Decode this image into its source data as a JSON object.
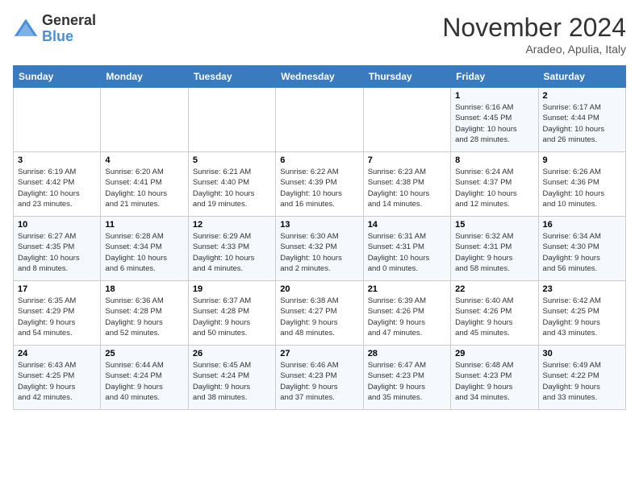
{
  "header": {
    "logo_line1": "General",
    "logo_line2": "Blue",
    "month": "November 2024",
    "location": "Aradeo, Apulia, Italy"
  },
  "weekdays": [
    "Sunday",
    "Monday",
    "Tuesday",
    "Wednesday",
    "Thursday",
    "Friday",
    "Saturday"
  ],
  "weeks": [
    [
      {
        "day": "",
        "info": ""
      },
      {
        "day": "",
        "info": ""
      },
      {
        "day": "",
        "info": ""
      },
      {
        "day": "",
        "info": ""
      },
      {
        "day": "",
        "info": ""
      },
      {
        "day": "1",
        "info": "Sunrise: 6:16 AM\nSunset: 4:45 PM\nDaylight: 10 hours\nand 28 minutes."
      },
      {
        "day": "2",
        "info": "Sunrise: 6:17 AM\nSunset: 4:44 PM\nDaylight: 10 hours\nand 26 minutes."
      }
    ],
    [
      {
        "day": "3",
        "info": "Sunrise: 6:19 AM\nSunset: 4:42 PM\nDaylight: 10 hours\nand 23 minutes."
      },
      {
        "day": "4",
        "info": "Sunrise: 6:20 AM\nSunset: 4:41 PM\nDaylight: 10 hours\nand 21 minutes."
      },
      {
        "day": "5",
        "info": "Sunrise: 6:21 AM\nSunset: 4:40 PM\nDaylight: 10 hours\nand 19 minutes."
      },
      {
        "day": "6",
        "info": "Sunrise: 6:22 AM\nSunset: 4:39 PM\nDaylight: 10 hours\nand 16 minutes."
      },
      {
        "day": "7",
        "info": "Sunrise: 6:23 AM\nSunset: 4:38 PM\nDaylight: 10 hours\nand 14 minutes."
      },
      {
        "day": "8",
        "info": "Sunrise: 6:24 AM\nSunset: 4:37 PM\nDaylight: 10 hours\nand 12 minutes."
      },
      {
        "day": "9",
        "info": "Sunrise: 6:26 AM\nSunset: 4:36 PM\nDaylight: 10 hours\nand 10 minutes."
      }
    ],
    [
      {
        "day": "10",
        "info": "Sunrise: 6:27 AM\nSunset: 4:35 PM\nDaylight: 10 hours\nand 8 minutes."
      },
      {
        "day": "11",
        "info": "Sunrise: 6:28 AM\nSunset: 4:34 PM\nDaylight: 10 hours\nand 6 minutes."
      },
      {
        "day": "12",
        "info": "Sunrise: 6:29 AM\nSunset: 4:33 PM\nDaylight: 10 hours\nand 4 minutes."
      },
      {
        "day": "13",
        "info": "Sunrise: 6:30 AM\nSunset: 4:32 PM\nDaylight: 10 hours\nand 2 minutes."
      },
      {
        "day": "14",
        "info": "Sunrise: 6:31 AM\nSunset: 4:31 PM\nDaylight: 10 hours\nand 0 minutes."
      },
      {
        "day": "15",
        "info": "Sunrise: 6:32 AM\nSunset: 4:31 PM\nDaylight: 9 hours\nand 58 minutes."
      },
      {
        "day": "16",
        "info": "Sunrise: 6:34 AM\nSunset: 4:30 PM\nDaylight: 9 hours\nand 56 minutes."
      }
    ],
    [
      {
        "day": "17",
        "info": "Sunrise: 6:35 AM\nSunset: 4:29 PM\nDaylight: 9 hours\nand 54 minutes."
      },
      {
        "day": "18",
        "info": "Sunrise: 6:36 AM\nSunset: 4:28 PM\nDaylight: 9 hours\nand 52 minutes."
      },
      {
        "day": "19",
        "info": "Sunrise: 6:37 AM\nSunset: 4:28 PM\nDaylight: 9 hours\nand 50 minutes."
      },
      {
        "day": "20",
        "info": "Sunrise: 6:38 AM\nSunset: 4:27 PM\nDaylight: 9 hours\nand 48 minutes."
      },
      {
        "day": "21",
        "info": "Sunrise: 6:39 AM\nSunset: 4:26 PM\nDaylight: 9 hours\nand 47 minutes."
      },
      {
        "day": "22",
        "info": "Sunrise: 6:40 AM\nSunset: 4:26 PM\nDaylight: 9 hours\nand 45 minutes."
      },
      {
        "day": "23",
        "info": "Sunrise: 6:42 AM\nSunset: 4:25 PM\nDaylight: 9 hours\nand 43 minutes."
      }
    ],
    [
      {
        "day": "24",
        "info": "Sunrise: 6:43 AM\nSunset: 4:25 PM\nDaylight: 9 hours\nand 42 minutes."
      },
      {
        "day": "25",
        "info": "Sunrise: 6:44 AM\nSunset: 4:24 PM\nDaylight: 9 hours\nand 40 minutes."
      },
      {
        "day": "26",
        "info": "Sunrise: 6:45 AM\nSunset: 4:24 PM\nDaylight: 9 hours\nand 38 minutes."
      },
      {
        "day": "27",
        "info": "Sunrise: 6:46 AM\nSunset: 4:23 PM\nDaylight: 9 hours\nand 37 minutes."
      },
      {
        "day": "28",
        "info": "Sunrise: 6:47 AM\nSunset: 4:23 PM\nDaylight: 9 hours\nand 35 minutes."
      },
      {
        "day": "29",
        "info": "Sunrise: 6:48 AM\nSunset: 4:23 PM\nDaylight: 9 hours\nand 34 minutes."
      },
      {
        "day": "30",
        "info": "Sunrise: 6:49 AM\nSunset: 4:22 PM\nDaylight: 9 hours\nand 33 minutes."
      }
    ]
  ]
}
